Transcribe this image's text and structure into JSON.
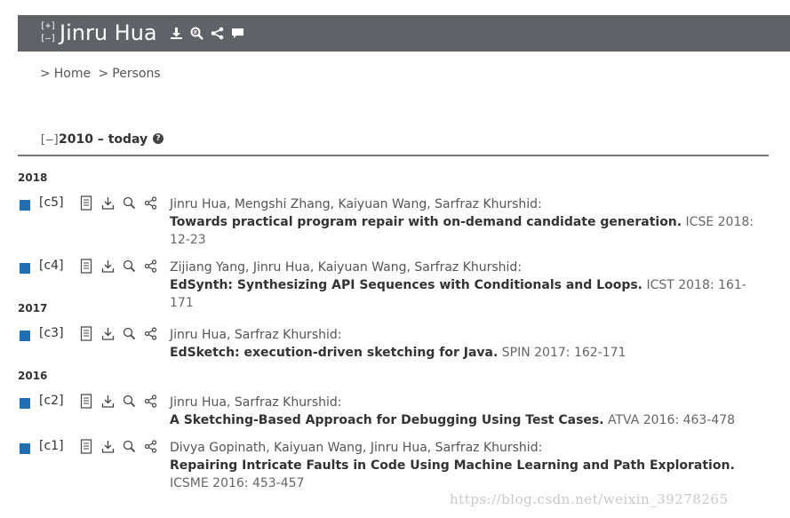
{
  "header": {
    "expand_label": "[+]",
    "collapse_label": "[–]",
    "title": "Jinru Hua",
    "icons": [
      "download-icon",
      "bibtex-icon",
      "share-icon",
      "comment-icon"
    ]
  },
  "breadcrumb": {
    "sep1": ">",
    "home": "Home",
    "sep2": ">",
    "persons": "Persons"
  },
  "section": {
    "toggle": "[–]",
    "title": "2010 – today",
    "help": "?"
  },
  "entries": [
    {
      "year": "2018",
      "key": "[c5]",
      "authors": "Jinru Hua, Mengshi Zhang, Kaiyuan Wang, Sarfraz Khurshid:",
      "title": "Towards practical program repair with on-demand candidate generation.",
      "venue": "ICSE 2018: 12-23"
    },
    {
      "key": "[c4]",
      "authors": "Zijiang Yang, Jinru Hua, Kaiyuan Wang, Sarfraz Khurshid:",
      "title": "EdSynth: Synthesizing API Sequences with Conditionals and Loops.",
      "venue": "ICST 2018: 161-171"
    },
    {
      "year": "2017",
      "key": "[c3]",
      "authors": "Jinru Hua, Sarfraz Khurshid:",
      "title": "EdSketch: execution-driven sketching for Java.",
      "venue": "SPIN 2017: 162-171"
    },
    {
      "year": "2016",
      "key": "[c2]",
      "authors": "Jinru Hua, Sarfraz Khurshid:",
      "title": "A Sketching-Based Approach for Debugging Using Test Cases.",
      "venue": "ATVA 2016: 463-478"
    },
    {
      "key": "[c1]",
      "authors": "Divya Gopinath, Kaiyuan Wang, Jinru Hua, Sarfraz Khurshid:",
      "title": "Repairing Intricate Faults in Code Using Machine Learning and Path Exploration.",
      "venue": "ICSME 2016: 453-457"
    }
  ],
  "watermark": "https://blog.csdn.net/weixin_39278265",
  "colors": {
    "header_bg": "#5f6368",
    "entry_marker": "#1f6fb2"
  }
}
